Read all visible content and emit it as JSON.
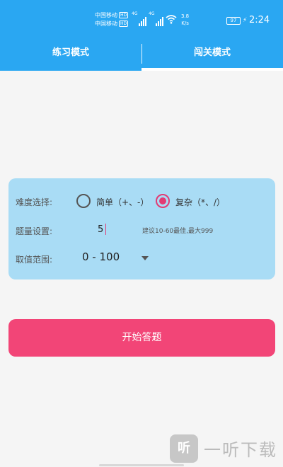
{
  "status_bar": {
    "carrier_1": "中国移动",
    "carrier_2": "中国移动",
    "hd": "HD",
    "net_1": "4G",
    "net_2": "4G",
    "speed_value": "3.8",
    "speed_unit": "K/s",
    "battery": "97",
    "time": "2:24"
  },
  "tabs": [
    {
      "label": "练习模式",
      "selected": false
    },
    {
      "label": "闯关模式",
      "selected": true
    }
  ],
  "settings": {
    "difficulty": {
      "label": "难度选择:",
      "options": [
        {
          "label": "简单（+、-）",
          "checked": false
        },
        {
          "label": "复杂（*、/）",
          "checked": true
        }
      ]
    },
    "quantity": {
      "label": "题量设置:",
      "value": "5",
      "hint": "建议10-60最佳,最大999"
    },
    "range": {
      "label": "取值范围:",
      "value": "0 - 100",
      "icon": "dropdown-arrow-icon"
    }
  },
  "start_button": {
    "label": "开始答题"
  },
  "watermark": {
    "badge": "听",
    "text": "一听下载"
  },
  "colors": {
    "header": "#2aa7f2",
    "card": "#a9dcf5",
    "accent": "#e23b74",
    "button": "#f24577"
  }
}
